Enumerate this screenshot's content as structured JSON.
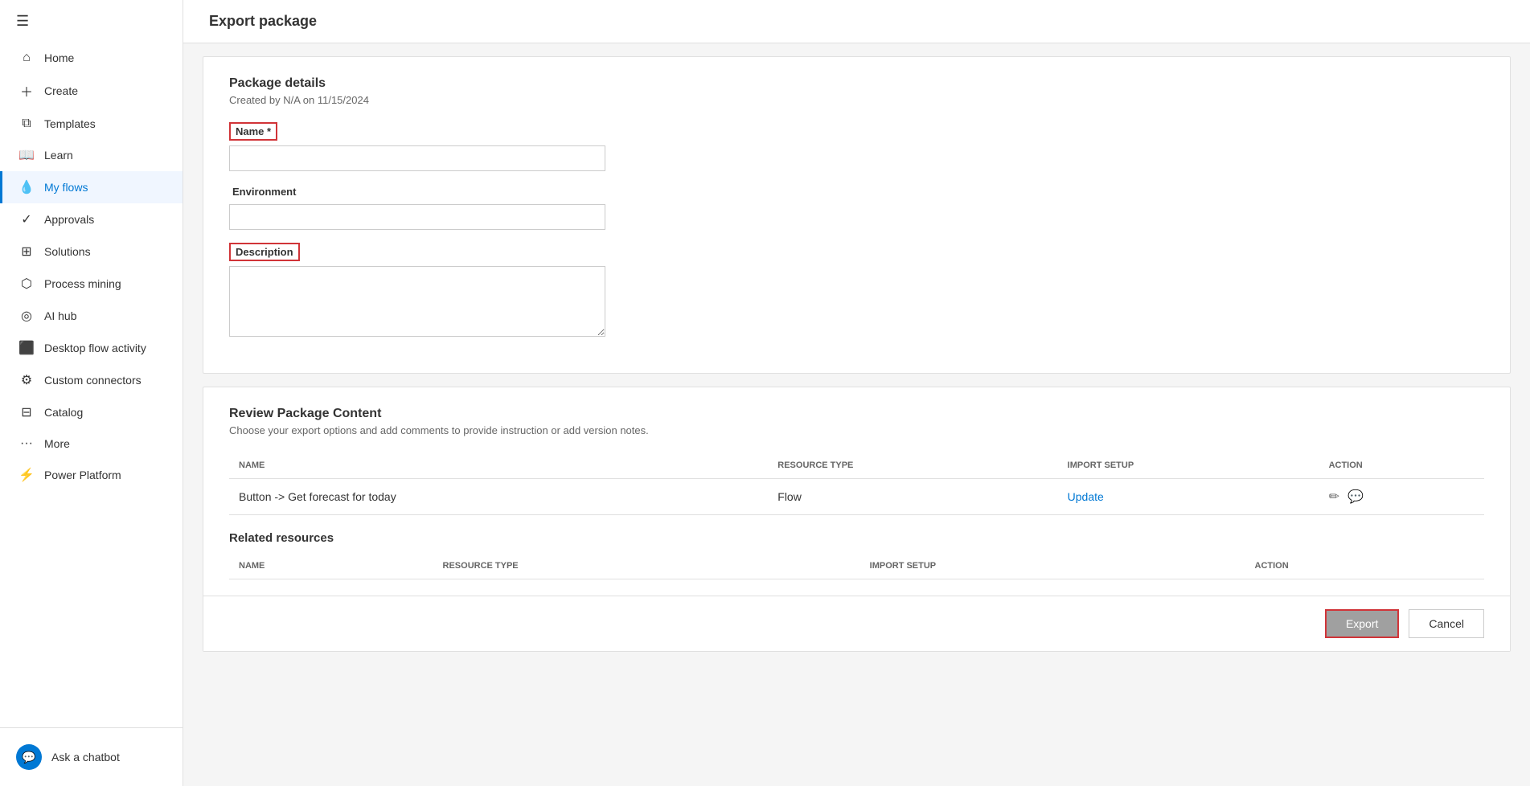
{
  "sidebar": {
    "hamburger_icon": "☰",
    "items": [
      {
        "id": "home",
        "label": "Home",
        "icon": "⌂",
        "active": false
      },
      {
        "id": "create",
        "label": "Create",
        "icon": "+",
        "active": false
      },
      {
        "id": "templates",
        "label": "Templates",
        "icon": "⧉",
        "active": false
      },
      {
        "id": "learn",
        "label": "Learn",
        "icon": "📖",
        "active": false
      },
      {
        "id": "my-flows",
        "label": "My flows",
        "icon": "💧",
        "active": true
      },
      {
        "id": "approvals",
        "label": "Approvals",
        "icon": "✓",
        "active": false
      },
      {
        "id": "solutions",
        "label": "Solutions",
        "icon": "⊞",
        "active": false
      },
      {
        "id": "process-mining",
        "label": "Process mining",
        "icon": "⬡",
        "active": false
      },
      {
        "id": "ai-hub",
        "label": "AI hub",
        "icon": "◎",
        "active": false
      },
      {
        "id": "desktop-flow-activity",
        "label": "Desktop flow activity",
        "icon": "⬛",
        "active": false
      },
      {
        "id": "custom-connectors",
        "label": "Custom connectors",
        "icon": "⚙",
        "active": false
      },
      {
        "id": "catalog",
        "label": "Catalog",
        "icon": "⊟",
        "active": false
      },
      {
        "id": "more",
        "label": "More",
        "icon": "···",
        "active": false
      },
      {
        "id": "power-platform",
        "label": "Power Platform",
        "icon": "⚡",
        "active": false
      }
    ],
    "chatbot_label": "Ask a chatbot",
    "chatbot_icon": "💬"
  },
  "page": {
    "title": "Export package",
    "package_details_title": "Package details",
    "created_by": "Created by N/A on 11/15/2024",
    "name_label": "Name *",
    "name_value": "",
    "environment_label": "Environment",
    "environment_value": "",
    "description_label": "Description",
    "description_value": "",
    "review_title": "Review Package Content",
    "review_subtitle": "Choose your export options and add comments to provide instruction or add version notes.",
    "table_headers": {
      "name": "NAME",
      "resource_type": "RESOURCE TYPE",
      "import_setup": "IMPORT SETUP",
      "action": "ACTION"
    },
    "table_rows": [
      {
        "name": "Button -> Get forecast for today",
        "resource_type": "Flow",
        "import_setup": "Update",
        "import_setup_link": true
      }
    ],
    "related_resources_title": "Related resources",
    "related_headers": {
      "name": "NAME",
      "resource_type": "RESOURCE TYPE",
      "import_setup": "IMPORT SETUP",
      "action": "ACTION"
    },
    "export_button_label": "Export",
    "cancel_button_label": "Cancel"
  }
}
